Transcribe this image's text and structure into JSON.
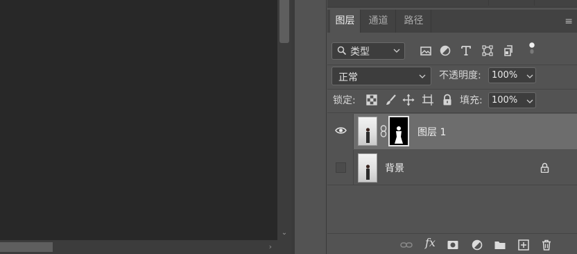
{
  "colors": {
    "canvas_bg": "#282828",
    "panel_bg": "#535353",
    "selected_row": "#6d6d6d"
  },
  "tabs": [
    {
      "label": "图层",
      "active": true
    },
    {
      "label": "通道",
      "active": false
    },
    {
      "label": "路径",
      "active": false
    }
  ],
  "filter": {
    "label": "类型",
    "icons": [
      "image-filter-icon",
      "adjustment-filter-icon",
      "type-filter-icon",
      "shape-filter-icon",
      "smartobject-filter-icon",
      "filter-toggle-icon"
    ]
  },
  "blend_mode": {
    "value": "正常"
  },
  "opacity": {
    "label": "不透明度:",
    "value": "100%"
  },
  "lock": {
    "label": "锁定:",
    "icons": [
      "lock-transparent-icon",
      "lock-image-icon",
      "lock-position-icon",
      "lock-artboard-icon",
      "lock-all-icon"
    ]
  },
  "fill": {
    "label": "填充:",
    "value": "100%"
  },
  "layers": [
    {
      "name": "图层 1",
      "visible": true,
      "selected": true,
      "has_mask": true,
      "locked": false
    },
    {
      "name": "背景",
      "visible": false,
      "selected": false,
      "has_mask": false,
      "locked": true
    }
  ],
  "bottom_icons": [
    "link-layers-icon",
    "fx-icon",
    "add-mask-icon",
    "adjustment-layer-icon",
    "new-group-icon",
    "new-layer-icon",
    "delete-layer-icon"
  ],
  "bottom_fx_label": "fx"
}
